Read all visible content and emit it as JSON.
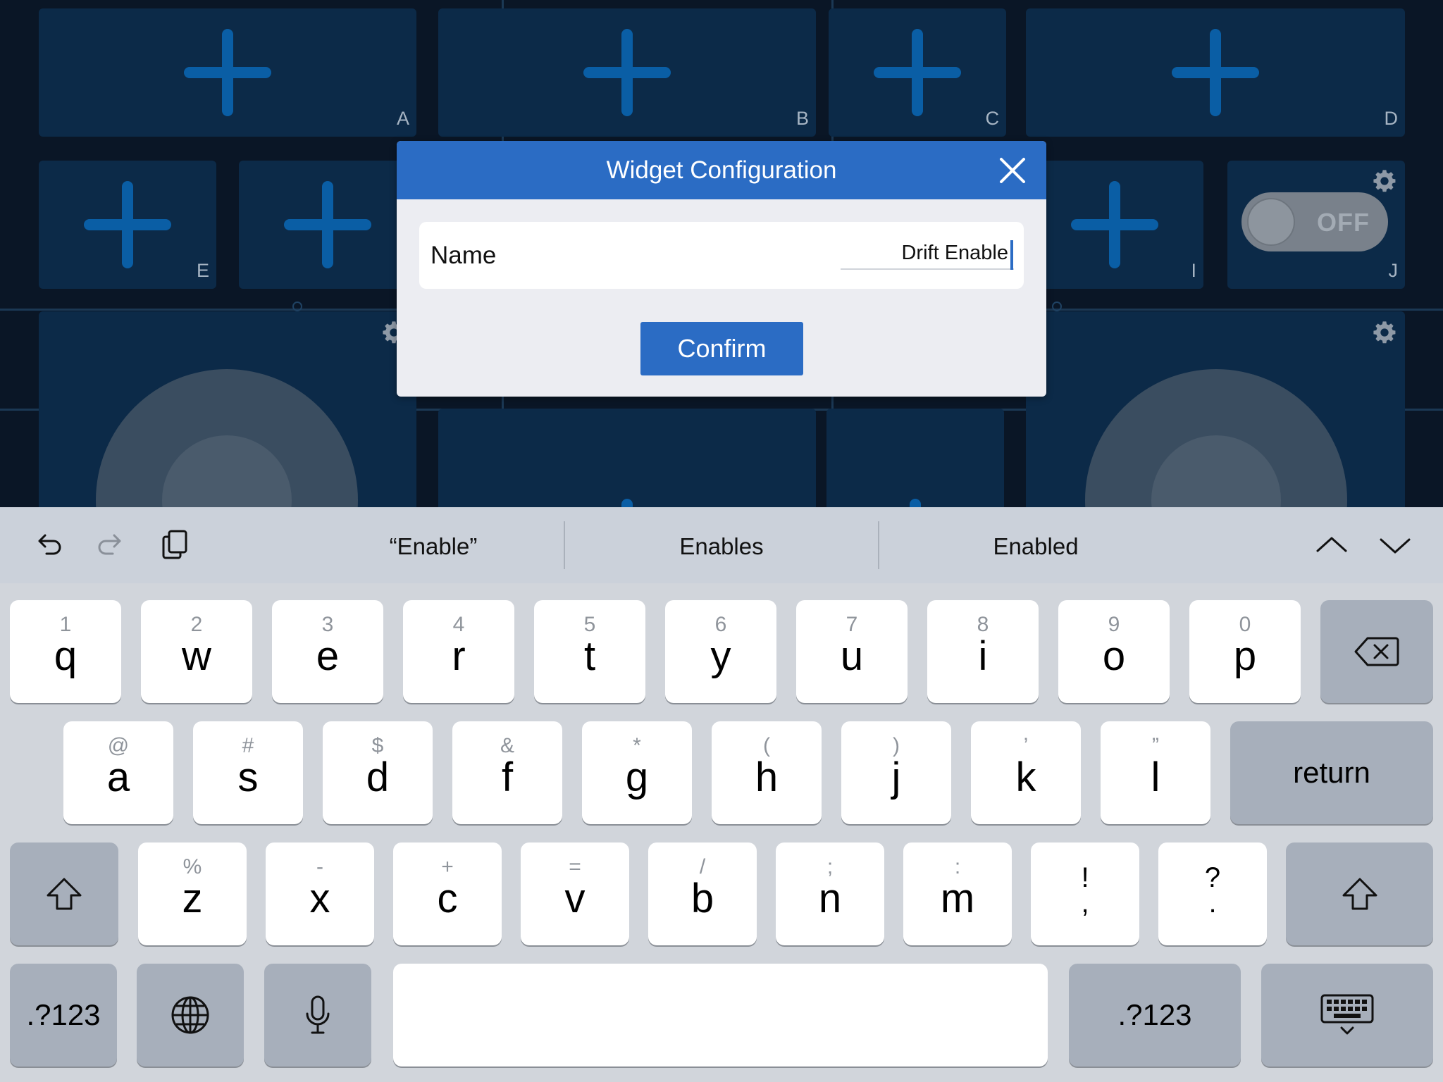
{
  "background": {
    "tiles": [
      {
        "label": "A"
      },
      {
        "label": "B"
      },
      {
        "label": "C"
      },
      {
        "label": "D"
      },
      {
        "label": "E"
      },
      {
        "label": ""
      },
      {
        "label": "I"
      },
      {
        "label": "J"
      }
    ],
    "toggle": {
      "state": "OFF"
    }
  },
  "dialog": {
    "title": "Widget Configuration",
    "name_label": "Name",
    "name_value": "Drift Enable",
    "confirm_label": "Confirm"
  },
  "keyboard": {
    "suggestions": [
      "“Enable”",
      "Enables",
      "Enabled"
    ],
    "row1": [
      {
        "alt": "1",
        "key": "q"
      },
      {
        "alt": "2",
        "key": "w"
      },
      {
        "alt": "3",
        "key": "e"
      },
      {
        "alt": "4",
        "key": "r"
      },
      {
        "alt": "5",
        "key": "t"
      },
      {
        "alt": "6",
        "key": "y"
      },
      {
        "alt": "7",
        "key": "u"
      },
      {
        "alt": "8",
        "key": "i"
      },
      {
        "alt": "9",
        "key": "o"
      },
      {
        "alt": "0",
        "key": "p"
      }
    ],
    "row2": [
      {
        "alt": "@",
        "key": "a"
      },
      {
        "alt": "#",
        "key": "s"
      },
      {
        "alt": "$",
        "key": "d"
      },
      {
        "alt": "&",
        "key": "f"
      },
      {
        "alt": "*",
        "key": "g"
      },
      {
        "alt": "(",
        "key": "h"
      },
      {
        "alt": ")",
        "key": "j"
      },
      {
        "alt": "’",
        "key": "k"
      },
      {
        "alt": "”",
        "key": "l"
      }
    ],
    "row3": [
      {
        "alt": "%",
        "key": "z"
      },
      {
        "alt": "-",
        "key": "x"
      },
      {
        "alt": "+",
        "key": "c"
      },
      {
        "alt": "=",
        "key": "v"
      },
      {
        "alt": "/",
        "key": "b"
      },
      {
        "alt": ";",
        "key": "n"
      },
      {
        "alt": ":",
        "key": "m"
      },
      {
        "alt": "!",
        "key": ","
      },
      {
        "alt": "?",
        "key": "."
      }
    ],
    "return_label": "return",
    "numbers_label": ".?123",
    "icons": {
      "undo": "undo-icon",
      "redo": "redo-icon",
      "paste": "paste-icon",
      "up": "chevron-up-icon",
      "down": "chevron-down-icon",
      "delete": "delete-icon",
      "shift": "shift-icon",
      "globe": "globe-icon",
      "mic": "microphone-icon",
      "hide": "keyboard-hide-icon",
      "gear": "gear-icon",
      "close": "close-icon",
      "plus": "plus-icon"
    }
  },
  "colors": {
    "dialog_header": "#2b6cc4",
    "confirm_button": "#2b6cc4",
    "tile_background": "#0c2a48",
    "plus_icon": "#0a5ea5",
    "keyboard_background": "#d1d5db"
  }
}
